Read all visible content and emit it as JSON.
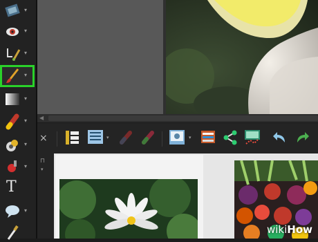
{
  "left_toolbar": {
    "tools": [
      {
        "name": "view-tool",
        "icon": "view-icon",
        "selected": false
      },
      {
        "name": "red-eye-tool",
        "icon": "eye-icon",
        "selected": false
      },
      {
        "name": "healing-tool",
        "icon": "healing-brush-icon",
        "selected": false
      },
      {
        "name": "brush-tool",
        "icon": "paint-brush-icon",
        "selected": true
      },
      {
        "name": "gradient-tool",
        "icon": "gradient-icon",
        "selected": false
      },
      {
        "name": "eraser-tool",
        "icon": "eraser-icon",
        "selected": false
      },
      {
        "name": "fill-tool",
        "icon": "paint-bucket-icon",
        "selected": false
      },
      {
        "name": "color-picker-tool",
        "icon": "color-replacer-icon",
        "selected": false
      },
      {
        "name": "text-tool",
        "icon": "text-icon",
        "selected": false
      },
      {
        "name": "shape-tool",
        "icon": "speech-bubble-icon",
        "selected": false
      },
      {
        "name": "eyedropper-tool",
        "icon": "eyedropper-icon",
        "selected": false
      }
    ],
    "highlight_color": "#2ad22a",
    "text_tool_glyph": "T"
  },
  "bin_toolbar": {
    "close_glyph": "×",
    "pin_glyph": "⊓",
    "icons": [
      "filmstrip-icon",
      "list-view-icon",
      "fill-icon",
      "color-fill-icon",
      "photo-icon",
      "image-stack-icon",
      "share-icon",
      "chart-icon",
      "undo-icon",
      "redo-icon"
    ]
  },
  "watermark": {
    "part1": "wiki",
    "part2": "How"
  }
}
